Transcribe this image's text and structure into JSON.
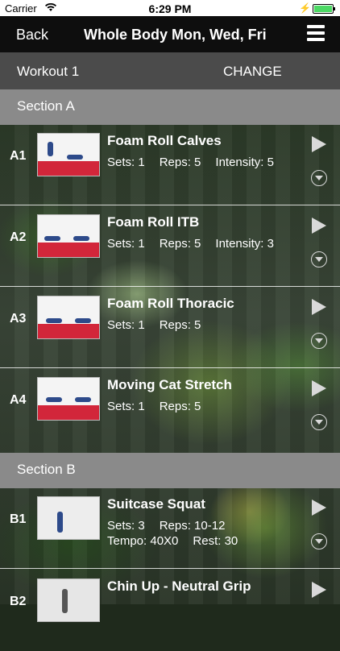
{
  "status_bar": {
    "carrier": "Carrier",
    "time": "6:29 PM"
  },
  "nav": {
    "back_label": "Back",
    "title": "Whole Body Mon, Wed, Fri",
    "menu_icon": "hamburger-menu-icon"
  },
  "workout": {
    "name": "Workout 1",
    "change_label": "CHANGE"
  },
  "sections": [
    {
      "title": "Section A",
      "exercises": [
        {
          "code": "A1",
          "name": "Foam Roll Calves",
          "sets": "Sets: 1",
          "reps": "Reps: 5",
          "extra": "Intensity: 5"
        },
        {
          "code": "A2",
          "name": "Foam Roll ITB",
          "sets": "Sets: 1",
          "reps": "Reps: 5",
          "extra": "Intensity: 3"
        },
        {
          "code": "A3",
          "name": "Foam Roll Thoracic",
          "sets": "Sets: 1",
          "reps": "Reps: 5"
        },
        {
          "code": "A4",
          "name": "Moving Cat Stretch",
          "sets": "Sets: 1",
          "reps": "Reps: 5"
        }
      ]
    },
    {
      "title": "Section B",
      "exercises": [
        {
          "code": "B1",
          "name": "Suitcase Squat",
          "sets": "Sets: 3",
          "reps": "Reps: 10-12",
          "tempo": "Tempo: 40X0",
          "rest": "Rest: 30"
        },
        {
          "code": "B2",
          "name": "Chin Up - Neutral Grip"
        }
      ]
    }
  ]
}
